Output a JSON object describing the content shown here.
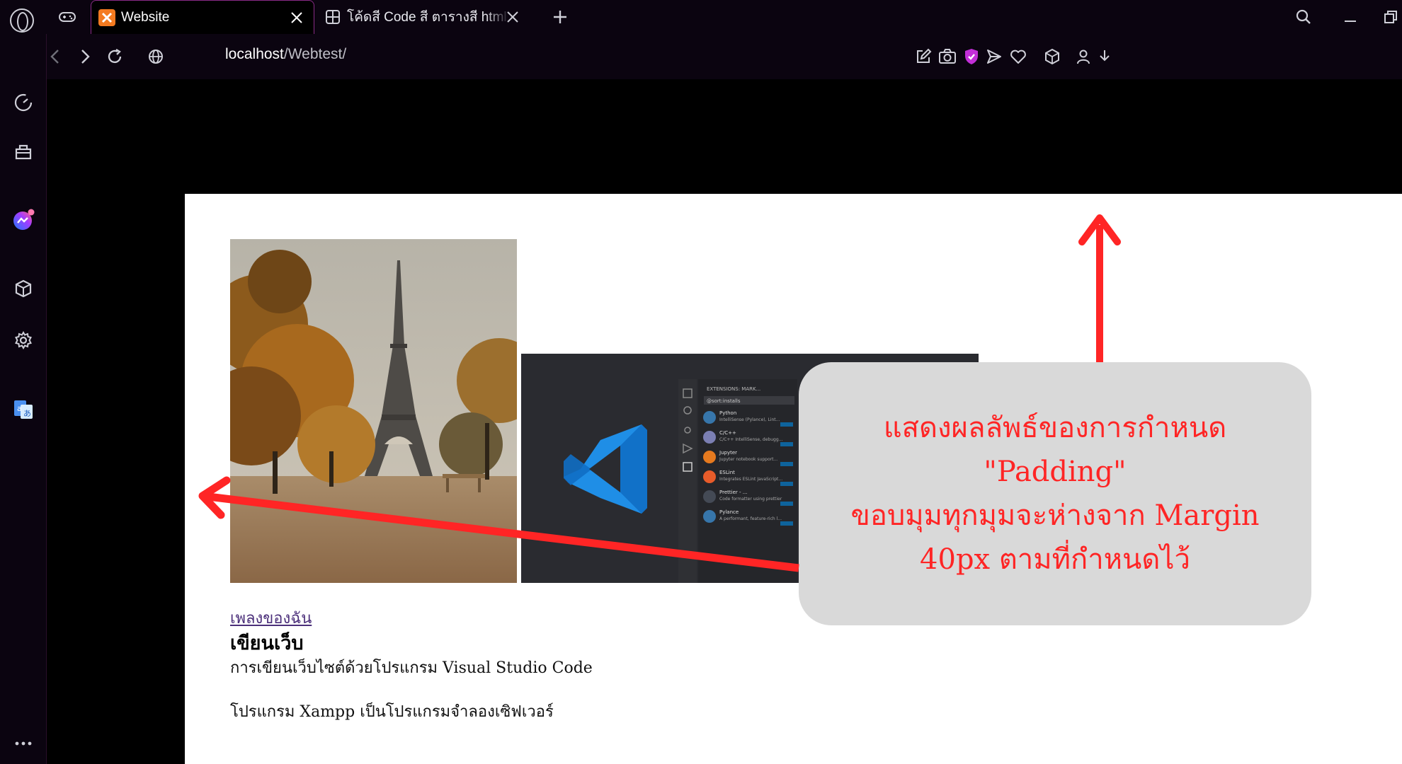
{
  "browser": {
    "tabs": [
      {
        "label": "Website",
        "active": true
      },
      {
        "label": "โค้ดสี Code สี ตารางสี html อั",
        "active": false
      }
    ],
    "address": {
      "host": "localhost",
      "path": "/Webtest/"
    }
  },
  "page": {
    "link_text": "เพลงของฉัน",
    "heading": "เขียนเว็บ",
    "paragraph_1": "การเขียนเว็บไซต์ด้วยโปรแกรม Visual Studio Code",
    "paragraph_2": "โปรแกรม Xampp เป็นโปรแกรมจำลองเซิฟเวอร์"
  },
  "annotation": {
    "line_1": "แสดงผลลัพธ์ของการกำหนด",
    "line_2": "\"Padding\"",
    "line_3": "ขอบมุมทุกมุมจะห่างจาก Margin",
    "line_4": "40px ตามที่กำหนดไว้"
  },
  "vscode_extensions": [
    {
      "name": "Python",
      "desc": "IntelliSense (Pylance), Lint..."
    },
    {
      "name": "C/C++",
      "desc": "C/C++ IntelliSense, debugg..."
    },
    {
      "name": "Jupyter",
      "desc": "Jupyter notebook support..."
    },
    {
      "name": "ESLint",
      "desc": "Integrates ESLint JavaScript..."
    },
    {
      "name": "Prettier - ...",
      "desc": "Code formatter using prettier"
    },
    {
      "name": "Pylance",
      "desc": "A performant, feature-rich l..."
    }
  ],
  "colors": {
    "accent": "#8a2b87",
    "annotation_red": "#ff2525",
    "annotation_bg": "#d9d9d9",
    "chrome_bg": "#0b0410"
  }
}
